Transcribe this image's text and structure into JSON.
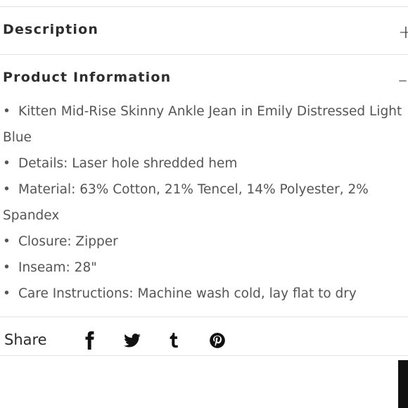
{
  "sections": {
    "description": {
      "title": "Description",
      "toggle": "+"
    },
    "product_information": {
      "title": "Product Information",
      "toggle": "–"
    }
  },
  "product_info": {
    "bullet": "•",
    "item_1_line_1": "Kitten Mid-Rise Skinny Ankle Jean in Emily Distressed Light",
    "item_1_line_2": "Blue",
    "item_2": "Details: Laser hole shredded hem",
    "item_3_line_1": "Material: 63% Cotton, 21% Tencel, 14% Polyester, 2%",
    "item_3_line_2": "Spandex",
    "item_4": "Closure: Zipper",
    "item_5": "Inseam: 28\"",
    "item_6": "Care Instructions: Machine wash cold, lay flat to dry"
  },
  "share": {
    "label": "Share",
    "icons": [
      "facebook-icon",
      "twitter-icon",
      "tumblr-icon",
      "pinterest-icon"
    ]
  },
  "colors": {
    "text": "#2b2b2b",
    "body_text": "#555555",
    "divider": "#e3e3e3"
  }
}
